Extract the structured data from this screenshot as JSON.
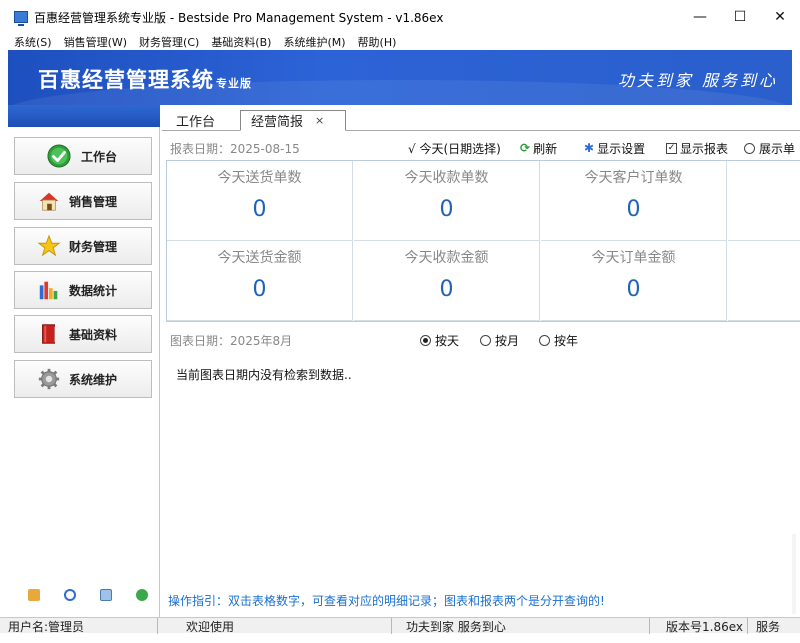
{
  "window": {
    "title": "百惠经营管理系统专业版 - Bestside Pro Management System - v1.86ex",
    "controls": [
      "—",
      "☐",
      "✕"
    ]
  },
  "menu": [
    "系统(S)",
    "销售管理(W)",
    "财务管理(C)",
    "基础资料(B)",
    "系统维护(M)",
    "帮助(H)"
  ],
  "banner": {
    "title": "百惠经营管理系统",
    "subtitle": "专业版",
    "slogan": "功夫到家 服务到心"
  },
  "sidebar": {
    "items": [
      {
        "label": "工作台",
        "icon": "check-circle-icon"
      },
      {
        "label": "销售管理",
        "icon": "house-icon"
      },
      {
        "label": "财务管理",
        "icon": "star-icon"
      },
      {
        "label": "数据统计",
        "icon": "bar-chart-icon"
      },
      {
        "label": "基础资料",
        "icon": "book-icon"
      },
      {
        "label": "系统维护",
        "icon": "gear-icon"
      }
    ],
    "mini_icons": [
      "key-icon",
      "clock-icon",
      "search-icon",
      "refresh-icon"
    ]
  },
  "tabs": [
    {
      "label": "工作台"
    },
    {
      "label": "经营简报",
      "close": "×"
    }
  ],
  "toolbar": {
    "report_date": "报表日期：2025-08-15",
    "today": "√ 今天(日期选择)",
    "refresh": "刷新",
    "display_settings": "显示设置",
    "show_report": "显示报表",
    "show_report_checked": true,
    "show_list": "展示单"
  },
  "stats": {
    "row1": [
      {
        "label": "今天送货单数",
        "value": "0"
      },
      {
        "label": "今天收款单数",
        "value": "0"
      },
      {
        "label": "今天客户订单数",
        "value": "0"
      },
      {
        "label": "今",
        "value": ""
      }
    ],
    "row2": [
      {
        "label": "今天送货金额",
        "value": "0"
      },
      {
        "label": "今天收款金额",
        "value": "0"
      },
      {
        "label": "今天订单金额",
        "value": "0"
      },
      {
        "label": "今",
        "value": ""
      }
    ]
  },
  "chart_controls": {
    "chart_date": "图表日期：2025年8月",
    "options": [
      "按天",
      "按月",
      "按年"
    ],
    "selected": "按天"
  },
  "empty_message": "当前图表日期内没有检索到数据..",
  "hint": "操作指引：双击表格数字，可查看对应的明细记录；图表和报表两个是分开查询的!",
  "status": {
    "user": "用户名:管理员",
    "welcome": "欢迎使用",
    "slogan": "功夫到家 服务到心",
    "version": "版本号1.86ex",
    "service": "服务"
  },
  "colors": {
    "banner": "#2c63d6",
    "stat_value": "#1e63b8",
    "hint": "#1a6fd0"
  }
}
